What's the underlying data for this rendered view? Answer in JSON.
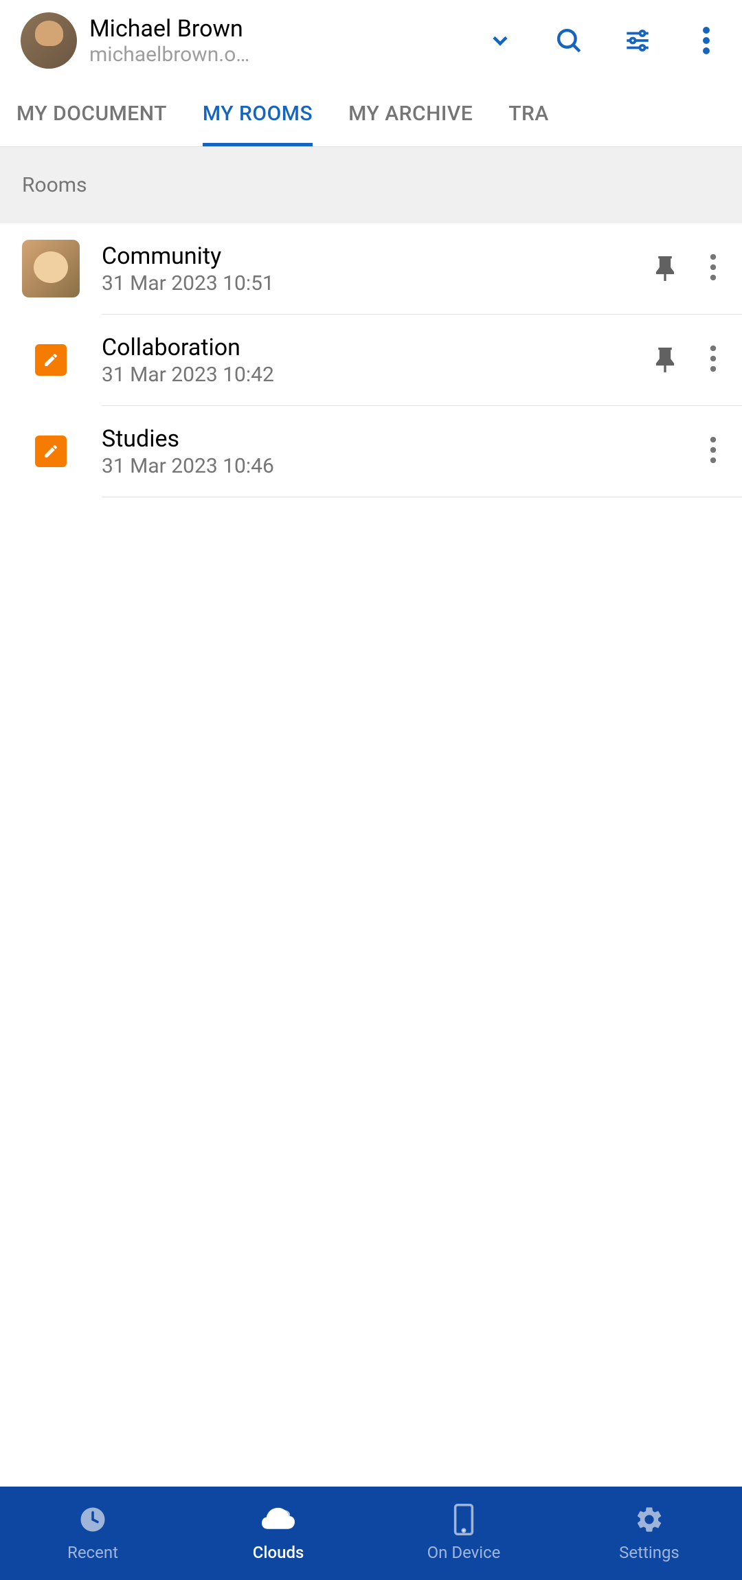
{
  "header": {
    "user_name": "Michael Brown",
    "user_subtitle": "michaelbrown.o…"
  },
  "tabs": [
    {
      "label": "MY DOCUMENT",
      "active": false
    },
    {
      "label": "MY ROOMS",
      "active": true
    },
    {
      "label": "MY ARCHIVE",
      "active": false
    },
    {
      "label": "TRA",
      "active": false
    }
  ],
  "section_title": "Rooms",
  "rooms": [
    {
      "name": "Community",
      "date": "31 Mar 2023 10:51",
      "pinned": true,
      "icon_type": "photo"
    },
    {
      "name": "Collaboration",
      "date": "31 Mar 2023 10:42",
      "pinned": true,
      "icon_type": "edit"
    },
    {
      "name": "Studies",
      "date": "31 Mar 2023 10:46",
      "pinned": false,
      "icon_type": "edit"
    }
  ],
  "nav": [
    {
      "label": "Recent",
      "icon": "clock"
    },
    {
      "label": "Clouds",
      "icon": "cloud",
      "active": true
    },
    {
      "label": "On Device",
      "icon": "phone"
    },
    {
      "label": "Settings",
      "icon": "gear"
    }
  ],
  "colors": {
    "primary_blue": "#1565c0",
    "nav_blue": "#0d47a1",
    "orange": "#f57c00"
  }
}
